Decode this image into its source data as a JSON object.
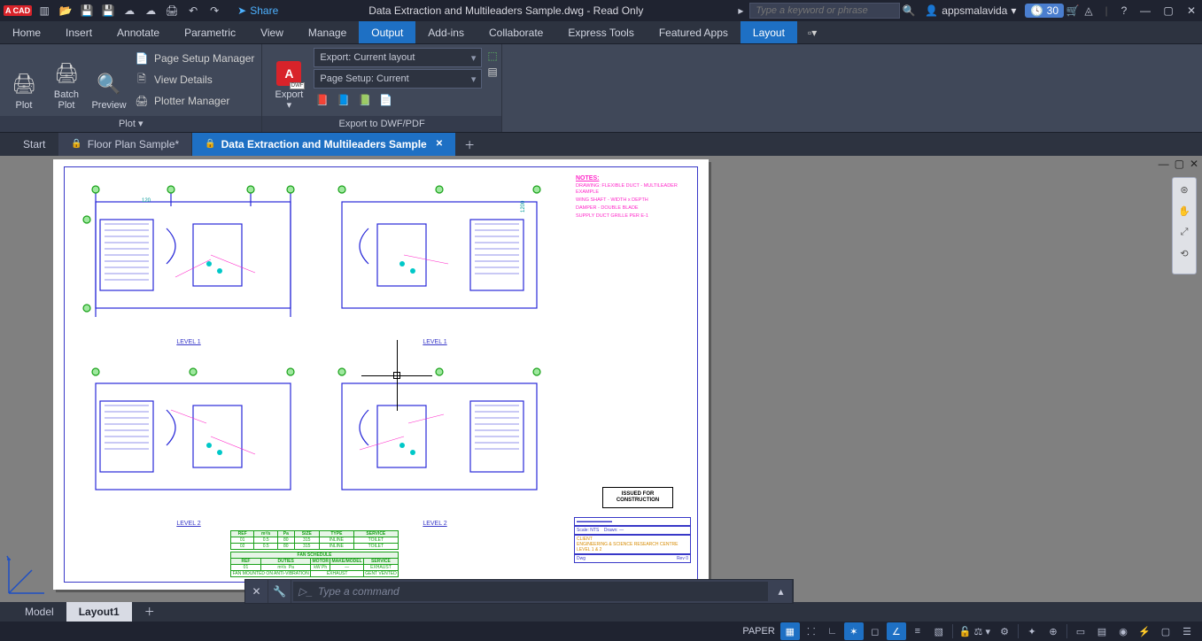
{
  "titlebar": {
    "app_badge": "A CAD",
    "share_label": "Share",
    "title": "Data Extraction and Multileaders Sample.dwg - Read Only",
    "search_placeholder": "Type a keyword or phrase",
    "username": "appsmalavida",
    "clock": "30"
  },
  "ribbon_tabs": [
    "Home",
    "Insert",
    "Annotate",
    "Parametric",
    "View",
    "Manage",
    "Output",
    "Add-ins",
    "Collaborate",
    "Express Tools",
    "Featured Apps",
    "Layout"
  ],
  "active_ribbon_tab": "Output",
  "plot_panel": {
    "title": "Plot",
    "plot": "Plot",
    "batch_plot": "Batch\nPlot",
    "preview": "Preview",
    "page_setup": "Page Setup Manager",
    "view_details": "View Details",
    "plotter_manager": "Plotter Manager"
  },
  "export_panel": {
    "title": "Export to DWF/PDF",
    "export": "Export",
    "export_combo": "Export: Current layout",
    "page_setup_combo": "Page Setup: Current"
  },
  "file_tabs": {
    "start": "Start",
    "tab1": "Floor Plan Sample*",
    "tab2": "Data Extraction and Multileaders Sample"
  },
  "drawing": {
    "notes_header": "NOTES:",
    "notes_lines": [
      "DRAWING: FLEXIBLE DUCT - MULTILEADER EXAMPLE",
      "WING SHAFT - WIDTH x DEPTH",
      "DAMPER - DOUBLE BLADE",
      "SUPPLY DUCT GRILLE PER E-1"
    ],
    "level1": "LEVEL 1",
    "level2": "LEVEL 2",
    "stamp": "ISSUED FOR\nCONSTRUCTION",
    "client": "CLIENT\nENGINEERING & SCIENCE RESEARCH CENTRE\nLEVEL 1 & 2",
    "schedule_title": "FAN SCHEDULE",
    "schedule_headers": [
      "REF",
      "DUTIES",
      "MOTOR",
      "MAKE/MODEL",
      "SERVICE"
    ]
  },
  "command": {
    "placeholder": "Type a command"
  },
  "layout_tabs": {
    "model": "Model",
    "layout1": "Layout1"
  },
  "status": {
    "space": "PAPER"
  }
}
